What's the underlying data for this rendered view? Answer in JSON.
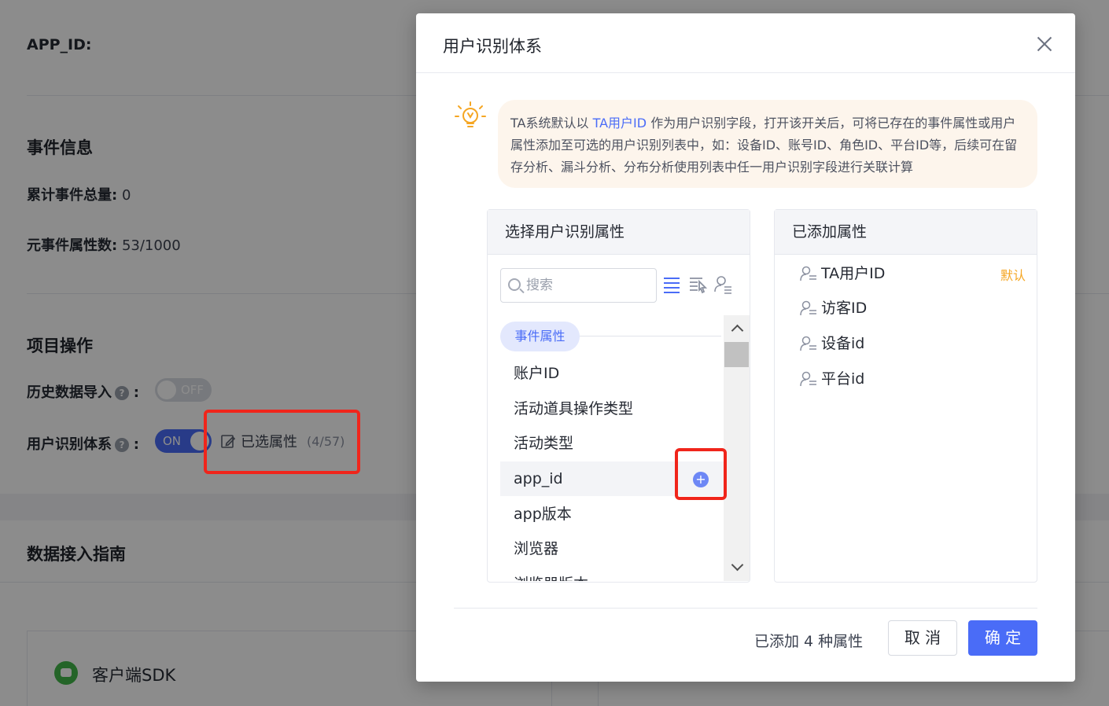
{
  "background": {
    "app_id_label": "APP_ID:",
    "event_info": {
      "title": "事件信息",
      "total_events_label": "累计事件总量:",
      "total_events_value": "0",
      "meta_props_label": "元事件属性数:",
      "meta_props_value": "53/1000"
    },
    "project_ops": {
      "title": "项目操作",
      "history_import_label": "历史数据导入",
      "history_import_toggle": "OFF",
      "user_id_system_label": "用户识别体系",
      "user_id_system_toggle": "ON",
      "selected_attrs_label": "已选属性",
      "selected_attrs_count": "(4/57)",
      "colon": ":",
      "help_mark": "?"
    },
    "guide": {
      "title": "数据接入指南",
      "client_sdk": "客户端SDK"
    }
  },
  "modal": {
    "title": "用户识别体系",
    "tip": {
      "before": "TA系统默认以 ",
      "highlight": "TA用户ID",
      "after": " 作为用户识别字段，打开该开关后，可将已存在的事件属性或用户属性添加至可选的用户识别列表中，如：设备ID、账号ID、角色ID、平台ID等，后续可在留存分析、漏斗分析、分布分析使用列表中任一用户识别字段进行关联计算"
    },
    "left_panel": {
      "title": "选择用户识别属性",
      "search_placeholder": "搜索",
      "group": "事件属性",
      "items": [
        "账户ID",
        "活动道具操作类型",
        "活动类型",
        "app_id",
        "app版本",
        "浏览器",
        "浏览器版本"
      ],
      "add_symbol": "+"
    },
    "right_panel": {
      "title": "已添加属性",
      "items": [
        "TA用户ID",
        "访客ID",
        "设备id",
        "平台id"
      ],
      "default_tag": "默认"
    },
    "footer": {
      "count_text": "已添加 4 种属性",
      "cancel": "取 消",
      "ok": "确 定"
    }
  },
  "colors": {
    "accent": "#4a6cf7",
    "highlight_red": "#f0251b",
    "default_tag": "#f5a623",
    "tip_bg": "#fdf5ec"
  },
  "icons": [
    "bulb-icon",
    "search-icon",
    "list-icon",
    "select-all-icon",
    "user-attr-icon",
    "user-icon",
    "add-icon",
    "close-icon",
    "edit-icon",
    "help-icon",
    "sdk-icon"
  ]
}
